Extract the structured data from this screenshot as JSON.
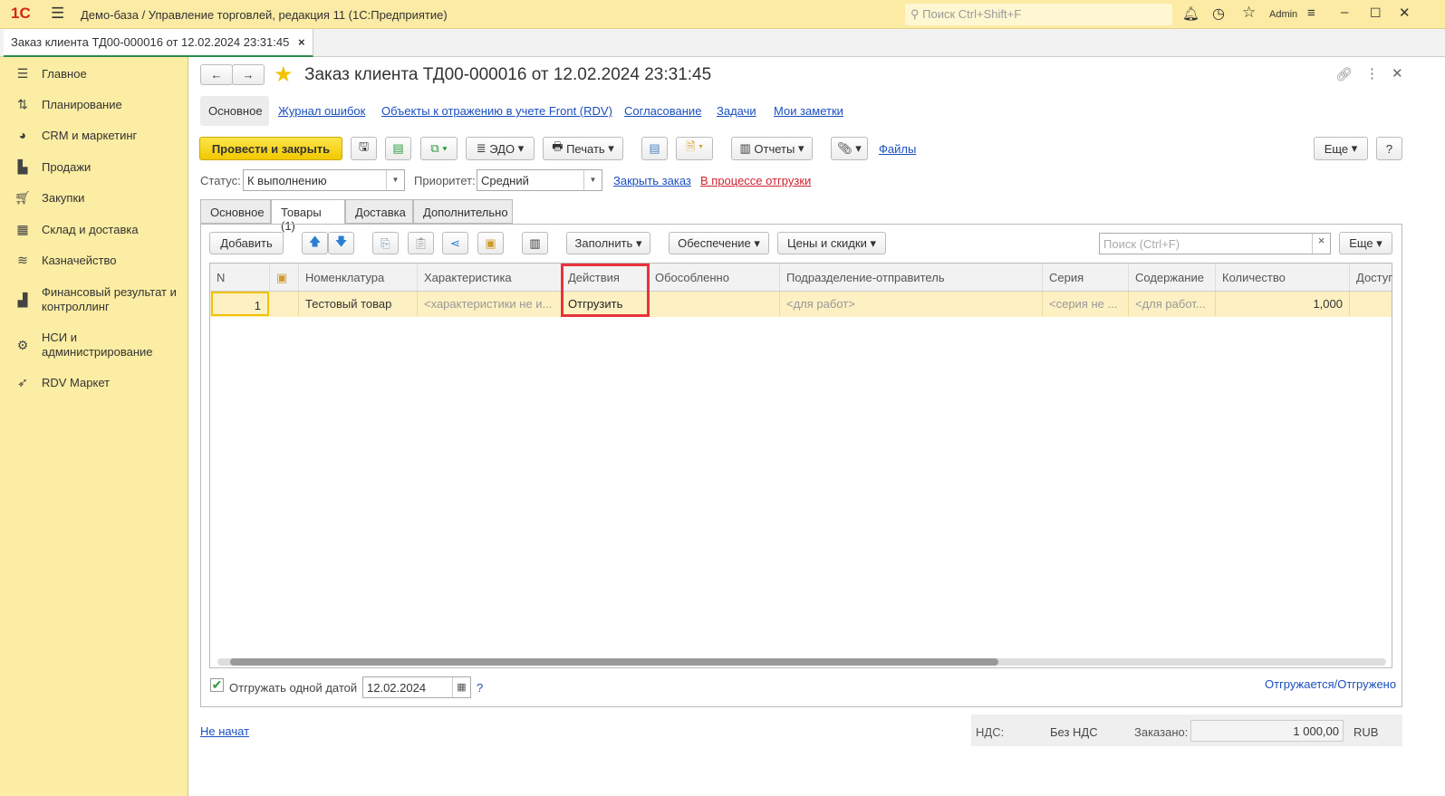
{
  "app": {
    "logo": "1С",
    "title": "Демо-база / Управление торговлей, редакция 11  (1С:Предприятие)",
    "search_placeholder": "Поиск Ctrl+Shift+F",
    "user": "Admin"
  },
  "doc_tab": {
    "label": "Заказ клиента ТД00-000016 от 12.02.2024 23:31:45"
  },
  "sidebar": {
    "items": [
      {
        "label": "Главное",
        "icon": "menu-icon"
      },
      {
        "label": "Планирование",
        "icon": "chart-icon"
      },
      {
        "label": "CRM и маркетинг",
        "icon": "pie-icon"
      },
      {
        "label": "Продажи",
        "icon": "bag-icon"
      },
      {
        "label": "Закупки",
        "icon": "cart-icon"
      },
      {
        "label": "Склад и доставка",
        "icon": "grid-icon"
      },
      {
        "label": "Казначейство",
        "icon": "coins-icon"
      },
      {
        "label": "Финансовый результат и контроллинг",
        "icon": "bar-chart-icon"
      },
      {
        "label": "НСИ и администрирование",
        "icon": "gear-icon"
      },
      {
        "label": "RDV Маркет",
        "icon": "rocket-icon"
      }
    ]
  },
  "form": {
    "title": "Заказ клиента ТД00-000016 от 12.02.2024 23:31:45",
    "nav": [
      "Основное",
      "Журнал ошибок",
      "Объекты к отражению в учете Front (RDV)",
      "Согласование",
      "Задачи",
      "Мои заметки"
    ],
    "toolbar": {
      "post_close": "Провести и закрыть",
      "edo": "ЭДО",
      "print": "Печать",
      "reports": "Отчеты",
      "files": "Файлы",
      "more": "Еще",
      "help": "?"
    },
    "status_label": "Статус:",
    "status_value": "К выполнению",
    "priority_label": "Приоритет:",
    "priority_value": "Средний",
    "close_order": "Закрыть заказ",
    "shipping_status": "В процессе отгрузки",
    "tabs": [
      "Основное",
      "Товары (1)",
      "Доставка",
      "Дополнительно"
    ],
    "goods_toolbar": {
      "add": "Добавить",
      "fill": "Заполнить",
      "provision": "Обеспечение",
      "prices": "Цены и скидки",
      "search_placeholder": "Поиск (Ctrl+F)",
      "clear": "×",
      "more": "Еще"
    },
    "table": {
      "columns": [
        "N",
        "",
        "Номенклатура",
        "Характеристика",
        "Действия",
        "Обособленно",
        "Подразделение-отправитель",
        "Серия",
        "Содержание",
        "Количество",
        "Доступ"
      ],
      "rows": [
        {
          "n": "1",
          "item": "Тестовый товар",
          "characteristic": "<характеристики не и...",
          "action": "Отгрузить",
          "separate": "",
          "department": "<для работ>",
          "series": "<серия не ...",
          "content": "<для работ...",
          "quantity": "1,000"
        }
      ]
    },
    "ship_one_date": "Отгружать одной датой",
    "ship_date": "12.02.2024",
    "help": "?",
    "shipped_link": "Отгружается/Отгружено",
    "footer": {
      "state_link": "Не начат",
      "vat_label": "НДС:",
      "vat_value": "Без НДС",
      "ordered_label": "Заказано:",
      "ordered_value": "1 000,00",
      "currency": "RUB"
    }
  }
}
